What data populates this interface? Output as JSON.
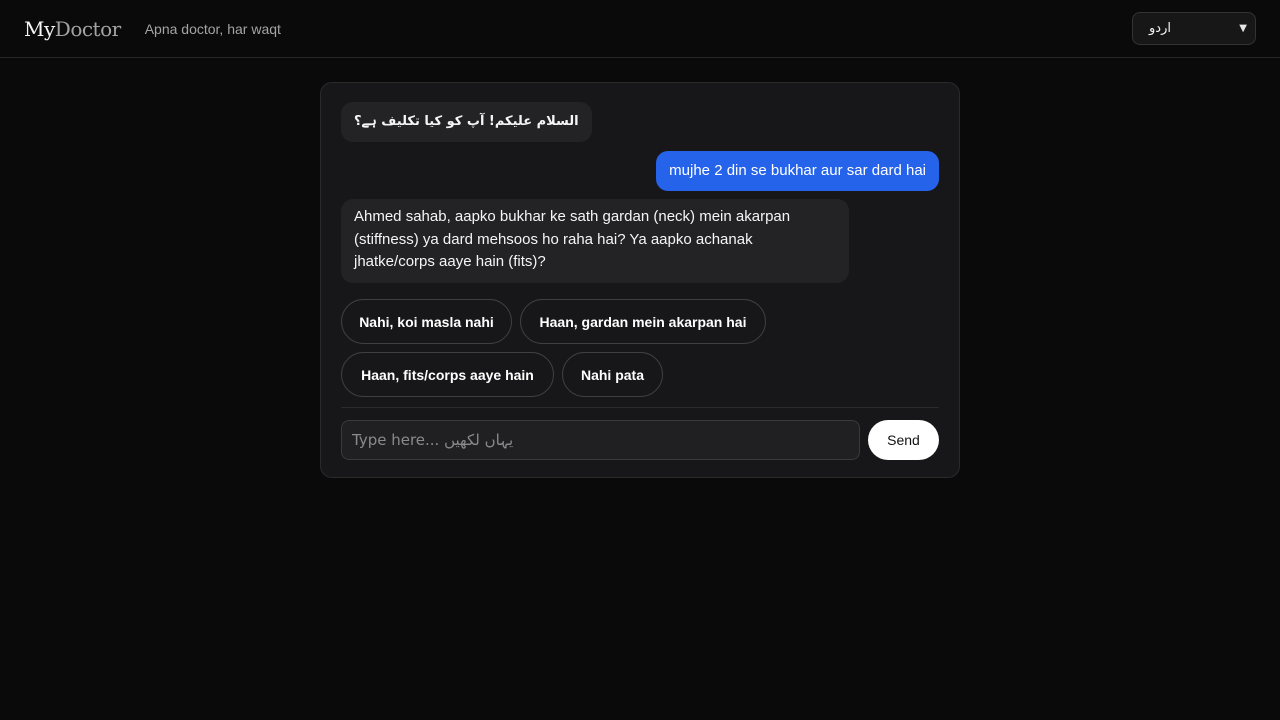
{
  "header": {
    "logo_my": "My",
    "logo_doctor": "Doctor",
    "tagline": "Apna doctor, har waqt",
    "language": {
      "selected": "اردو",
      "icon": "chevron-down-icon"
    }
  },
  "chat": {
    "messages": [
      {
        "role": "bot",
        "text": "السلام علیکم! آپ کو کیا تکلیف ہے؟"
      },
      {
        "role": "user",
        "text": "mujhe 2 din se bukhar aur sar dard hai"
      },
      {
        "role": "bot",
        "text": "Ahmed sahab, aapko bukhar ke sath gardan (neck) mein akarpan (stiffness) ya dard mehsoos ho raha hai? Ya aapko achanak jhatke/corps aaye hain (fits)?"
      }
    ],
    "quick_replies": [
      "Nahi, koi masla nahi",
      "Haan, gardan mein akarpan hai",
      "Haan, fits/corps aaye hain",
      "Nahi pata"
    ],
    "input": {
      "placeholder": "Type here... یہاں لکھیں",
      "value": ""
    },
    "send_label": "Send"
  },
  "colors": {
    "background": "#0a0a0a",
    "card": "#171719",
    "user_bubble": "#2563eb",
    "bot_bubble": "#232325"
  }
}
